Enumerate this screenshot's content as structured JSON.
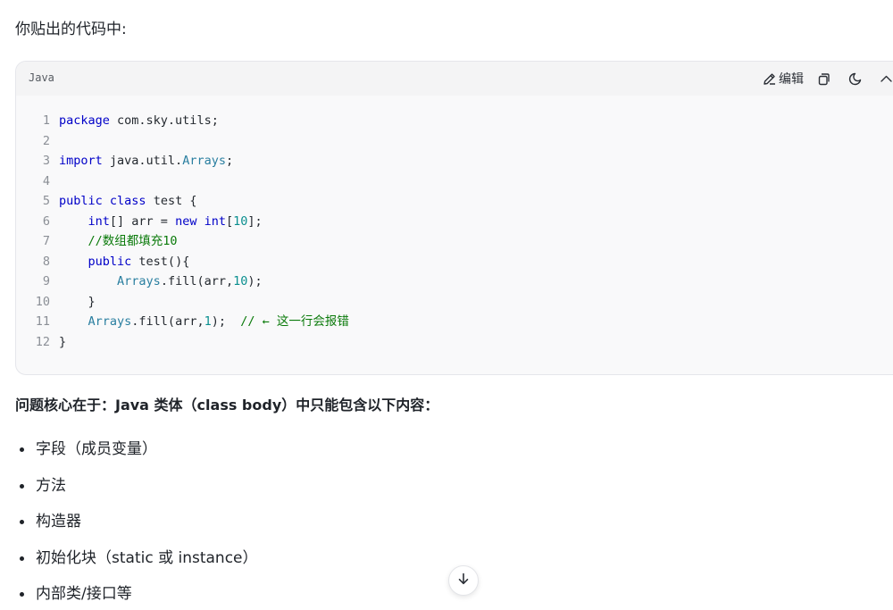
{
  "intro_text": "你贴出的代码中:",
  "code_block": {
    "language": "Java",
    "edit_label": "编辑",
    "line_numbers": [
      "1",
      "2",
      "3",
      "4",
      "5",
      "6",
      "7",
      "8",
      "9",
      "10",
      "11",
      "12"
    ],
    "tokens": {
      "l1_kw": "package",
      "l1_rest": " com.sky.utils;",
      "l3_kw": "import",
      "l3_mid": " java.util.",
      "l3_type": "Arrays",
      "l3_end": ";",
      "l5_kw1": "public",
      "l5_kw2": "class",
      "l5_rest": " test {",
      "l6_type": "int",
      "l6_a": "[] arr = ",
      "l6_kw": "new",
      "l6_type2": "int",
      "l6_b": "[",
      "l6_num": "10",
      "l6_c": "];",
      "l7_comment": "//数组都填充10",
      "l8_kw": "public",
      "l8_rest": " test(){",
      "l9_type": "Arrays",
      "l9_a": ".fill(arr,",
      "l9_num": "10",
      "l9_b": ");",
      "l10_rest": "}",
      "l11_type": "Arrays",
      "l11_a": ".fill(arr,",
      "l11_num": "1",
      "l11_b": ");  ",
      "l11_comment": "// ← 这一行会报错",
      "l12_rest": "}"
    }
  },
  "section_title": "问题核心在于：Java 类体（class body）中只能包含以下内容：",
  "list_items": [
    "字段（成员变量）",
    "方法",
    "构造器",
    "初始化块（static 或 instance）",
    "内部类/接口等"
  ],
  "icons": {
    "edit": "pencil-icon",
    "copy": "copy-icon",
    "theme": "moon-icon",
    "collapse": "chevron-up-icon",
    "scroll": "arrow-down-icon"
  }
}
